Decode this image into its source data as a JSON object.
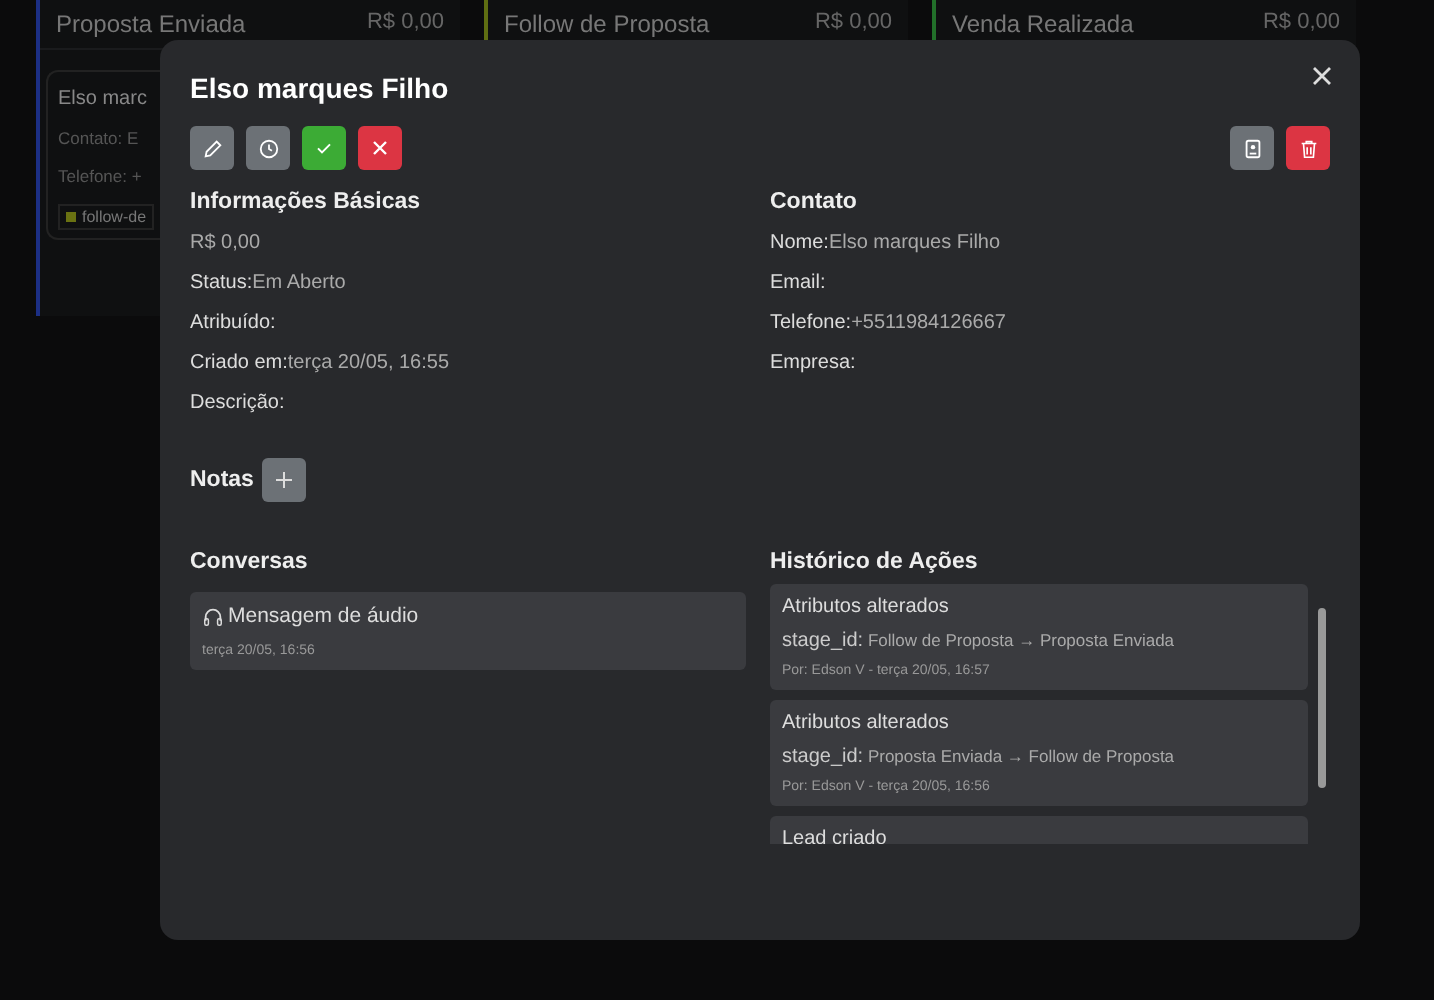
{
  "board": {
    "columns": [
      {
        "title": "Proposta Enviada",
        "total": "R$ 0,00",
        "color": "#1c2f85"
      },
      {
        "title": "Follow de Proposta",
        "total": "R$ 0,00",
        "color": "#5f6e12"
      },
      {
        "title": "Venda Realizada",
        "total": "R$ 0,00",
        "color": "#22702a"
      }
    ],
    "card": {
      "title": "Elso marc",
      "lines": [
        "Contato: E",
        "Telefone: +"
      ],
      "tag": {
        "label": "follow-de",
        "color": "#6a7212"
      }
    }
  },
  "modal": {
    "title": "Elso marques Filho",
    "basic": {
      "heading": "Informações Básicas",
      "amount": "R$ 0,00",
      "fields": [
        {
          "label": "Status:",
          "value": "Em Aberto"
        },
        {
          "label": "Atribuído:"
        },
        {
          "label": "Criado em:",
          "value": "terça 20/05, 16:55"
        },
        {
          "label": "Descrição:"
        }
      ]
    },
    "contact": {
      "heading": "Contato",
      "fields": [
        {
          "label": "Nome:",
          "value": "Elso marques Filho"
        },
        {
          "label": "Email:"
        },
        {
          "label": "Telefone:",
          "value": "+5511984126667"
        },
        {
          "label": "Empresa:"
        }
      ]
    },
    "notes": {
      "heading": "Notas"
    },
    "conversations": {
      "heading": "Conversas",
      "items": [
        {
          "title": "Mensagem de áudio",
          "time": "terça 20/05, 16:56"
        }
      ]
    },
    "history": {
      "heading": "Histórico de Ações",
      "items": [
        {
          "title": "Atributos alterados",
          "field": "stage_id:",
          "change": "Follow de Proposta → Proposta Enviada",
          "meta": "Por: Edson V - terça 20/05, 16:57"
        },
        {
          "title": "Atributos alterados",
          "field": "stage_id:",
          "change": "Proposta Enviada → Follow de Proposta",
          "meta": "Por: Edson V - terça 20/05, 16:56"
        },
        {
          "title": "Lead criado"
        }
      ]
    }
  }
}
